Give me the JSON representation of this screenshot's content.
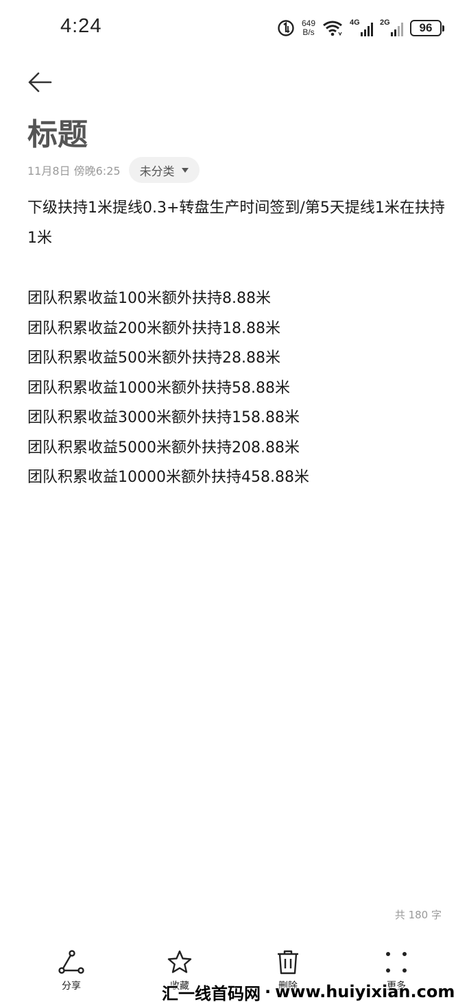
{
  "status_bar": {
    "time": "4:24",
    "net_speed_value": "649",
    "net_speed_unit": "B/s",
    "signal_1_label": "4G",
    "signal_2_label": "2G",
    "battery": "96"
  },
  "note": {
    "title": "标题",
    "date": "11月8日 傍晚6:25",
    "category": "未分类",
    "intro": "下级扶持1米提线0.3+转盘生产时间签到/第5天提线1米在扶持1米",
    "lines": [
      "团队积累收益100米额外扶持8.88米",
      "团队积累收益200米额外扶持18.88米",
      "团队积累收益500米额外扶持28.88米",
      "团队积累收益1000米额外扶持58.88米",
      "团队积累收益3000米额外扶持158.88米",
      "团队积累收益5000米额外扶持208.88米",
      "团队积累收益10000米额外扶持458.88米"
    ],
    "word_count": "共 180 字"
  },
  "bottom_bar": {
    "share": "分享",
    "favorite": "收藏",
    "delete": "删除",
    "more": "更多"
  },
  "watermark": {
    "cn": "汇一线首码网",
    "sep": "·",
    "url": "www.huiyixian.com"
  }
}
